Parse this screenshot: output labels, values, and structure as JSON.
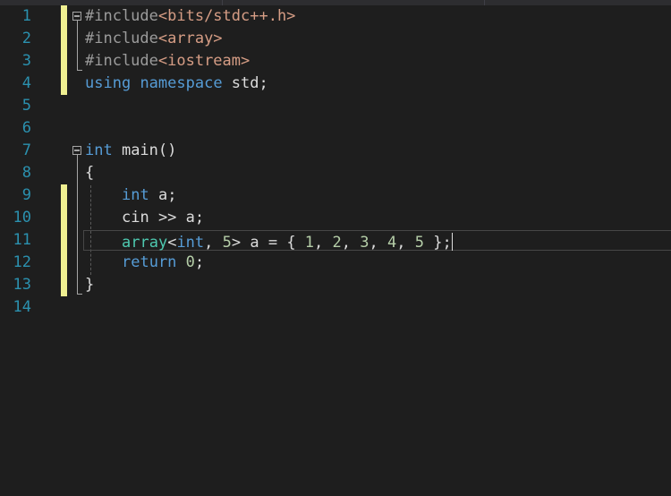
{
  "editor": {
    "line_numbers": [
      "1",
      "2",
      "3",
      "4",
      "5",
      "6",
      "7",
      "8",
      "9",
      "10",
      "11",
      "12",
      "13",
      "14"
    ],
    "lines": {
      "l1": {
        "directive": "#include",
        "header": "<bits/stdc++.h>"
      },
      "l2": {
        "directive": "#include",
        "header": "<array>"
      },
      "l3": {
        "directive": "#include",
        "header": "<iostream>"
      },
      "l4": {
        "kw1": "using",
        "kw2": "namespace",
        "rest": " std;"
      },
      "l7": {
        "type": "int",
        "rest": " main()"
      },
      "l8": {
        "text": "{"
      },
      "l9": {
        "type": "int",
        "rest": " a;"
      },
      "l10": {
        "text": "cin >> a;"
      },
      "l11": {
        "tmpl": "array",
        "lt": "<",
        "type": "int",
        "comma": ", ",
        "n": "5",
        "gt": ">",
        "mid": " a = { ",
        "v1": "1",
        "s1": ", ",
        "v2": "2",
        "s2": ", ",
        "v3": "3",
        "s3": ", ",
        "v4": "4",
        "s4": ", ",
        "v5": "5",
        "end": " };"
      },
      "l12": {
        "kw": "return",
        "sp": " ",
        "n": "0",
        "end": ";"
      },
      "l13": {
        "text": "}"
      }
    },
    "colors": {
      "background": "#1e1e1e",
      "line_number": "#2b91af",
      "keyword": "#569cd6",
      "string": "#d69d85",
      "number": "#b5cea8",
      "type": "#4ec9b0",
      "change_marker": "#efef91"
    }
  }
}
